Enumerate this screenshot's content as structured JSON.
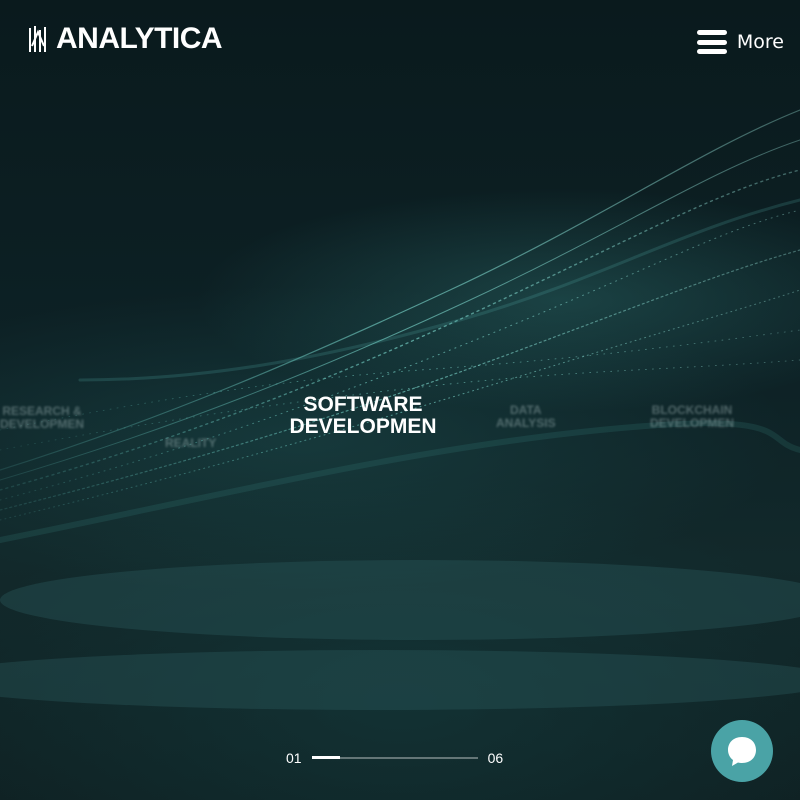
{
  "brand": {
    "name": "ANALYTICA"
  },
  "menu": {
    "label": "More"
  },
  "slides": {
    "current_title_line1": "SOFTWARE",
    "current_title_line2": "DEVELOPMEN",
    "ghost_research_1": "RESEARCH &",
    "ghost_research_2": "DEVELOPMEN",
    "ghost_reality": "REALITY",
    "ghost_data_1": "DATA",
    "ghost_data_2": "ANALYSIS",
    "ghost_blockchain_1": "BLOCKCHAIN",
    "ghost_blockchain_2": "DEVELOPMEN"
  },
  "pager": {
    "current": "01",
    "total": "06",
    "progress": 0.17
  },
  "colors": {
    "accent": "#4aa3a6",
    "background": "#0b1c1f"
  },
  "icons": {
    "menu": "hamburger-icon",
    "chat": "chat-bubble-icon",
    "logo": "analytica-logo-icon"
  }
}
